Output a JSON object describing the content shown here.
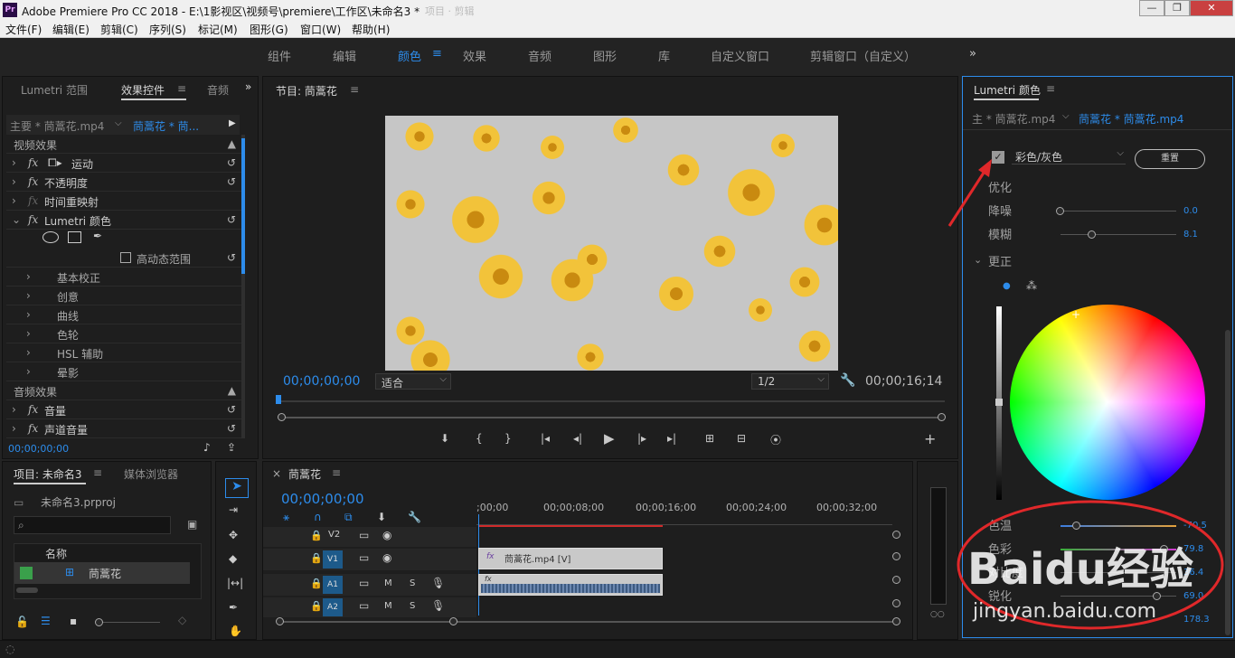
{
  "window": {
    "title": "Adobe Premiere Pro CC 2018 - E:\\1影视区\\视频号\\premiere\\工作区\\未命名3 *",
    "logo": "Pr",
    "ghost_tab": "项目 · 剪辑"
  },
  "menu": [
    "文件(F)",
    "编辑(E)",
    "剪辑(C)",
    "序列(S)",
    "标记(M)",
    "图形(G)",
    "窗口(W)",
    "帮助(H)"
  ],
  "workspaces": [
    {
      "label": "组件",
      "active": false
    },
    {
      "label": "编辑",
      "active": false
    },
    {
      "label": "颜色",
      "active": true
    },
    {
      "label": "效果",
      "active": false
    },
    {
      "label": "音频",
      "active": false
    },
    {
      "label": "图形",
      "active": false
    },
    {
      "label": "库",
      "active": false
    },
    {
      "label": "自定义窗口",
      "active": false
    },
    {
      "label": "剪辑窗口（自定义）",
      "active": false
    }
  ],
  "effect_controls": {
    "tabs": [
      "Lumetri 范围",
      "效果控件",
      "音频"
    ],
    "master_clip": "主要 * 茼蒿花.mp4",
    "seq_clip": "茼蒿花 * 茼...",
    "video_header": "视频效果",
    "video_effects": [
      "运动",
      "不透明度",
      "时间重映射",
      "Lumetri 颜色"
    ],
    "hdr_label": "高动态范围",
    "lumetri_sections": [
      "基本校正",
      "创意",
      "曲线",
      "色轮",
      "HSL 辅助",
      "晕影"
    ],
    "audio_header": "音频效果",
    "audio_effects": [
      "音量",
      "声道音量"
    ],
    "timecode": "00;00;00;00"
  },
  "program": {
    "title": "节目: 茼蒿花",
    "timecode_left": "00;00;00;00",
    "fit": "适合",
    "resolution": "1/2",
    "timecode_right": "00;00;16;14"
  },
  "project": {
    "tabs": [
      "项目: 未命名3",
      "媒体浏览器"
    ],
    "file": "未命名3.prproj",
    "column_name": "名称",
    "item": "茼蒿花"
  },
  "timeline": {
    "title": "茼蒿花",
    "timecode": "00;00;00;00",
    "ruler": [
      ";00;00",
      "00;00;08;00",
      "00;00;16;00",
      "00;00;24;00",
      "00;00;32;00"
    ],
    "tracks": [
      {
        "label": "V2",
        "type": "video"
      },
      {
        "label": "V1",
        "type": "video"
      },
      {
        "label": "A1",
        "type": "audio"
      },
      {
        "label": "A2",
        "type": "audio"
      }
    ],
    "video_clip": "茼蒿花.mp4 [V]",
    "audio_clip": "fx",
    "m": "M",
    "s": "S"
  },
  "lumetri": {
    "title": "Lumetri 颜色",
    "master": "主 * 茼蒿花.mp4",
    "seq": "茼蒿花 * 茼蒿花.mp4",
    "look": "彩色/灰色",
    "reset": "重置",
    "optimize": "优化",
    "denoise_label": "降噪",
    "denoise_value": "0.0",
    "blur_label": "模糊",
    "blur_value": "8.1",
    "correction": "更正",
    "temp_label": "色温",
    "temp_value": "-70.5",
    "tint_label": "色彩",
    "tint_value": "79.8",
    "contrast_label": "对比度",
    "contrast_value": "36.4",
    "sharpen_label": "锐化",
    "sharpen_value": "69.0",
    "saturation_value": "178.3"
  },
  "watermark": {
    "brand": "Baidu经验",
    "url": "jingyan.baidu.com"
  },
  "colors": {
    "accent": "#2d8ceb",
    "annotation": "#e0282a",
    "panel": "#1e1e1e"
  }
}
